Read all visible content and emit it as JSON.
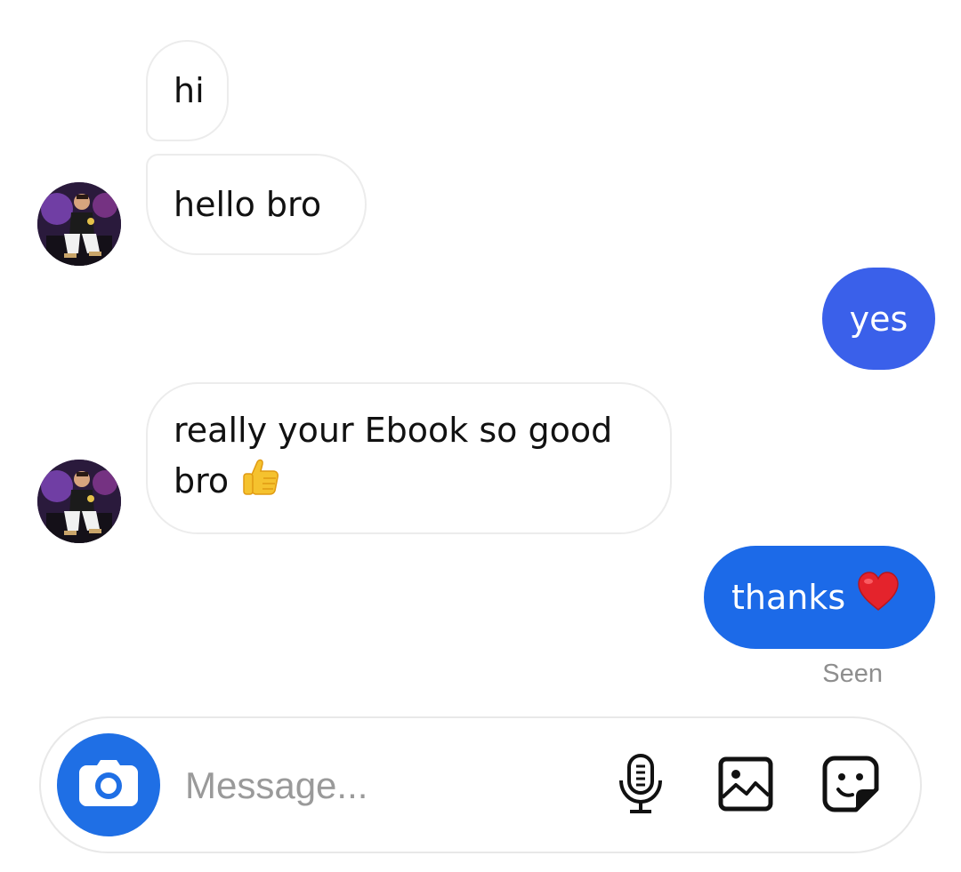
{
  "conversation": {
    "messages": [
      {
        "text": "hi",
        "sender": "other"
      },
      {
        "text": "hello bro",
        "sender": "other"
      },
      {
        "text": "yes",
        "sender": "me"
      },
      {
        "line1": "really your Ebook so good",
        "line2": "bro",
        "emoji": "thumbs-up",
        "sender": "other"
      },
      {
        "text": "thanks",
        "emoji": "red-heart",
        "sender": "me"
      }
    ],
    "seen_label": "Seen"
  },
  "composer": {
    "placeholder": "Message...",
    "camera_icon": "camera-icon",
    "mic_icon": "microphone-icon",
    "gallery_icon": "image-icon",
    "sticker_icon": "sticker-icon"
  },
  "colors": {
    "outgoing_bubble_1": "#3a60ea",
    "outgoing_bubble_2": "#1c6ae8",
    "camera_button": "#1f6fe5",
    "incoming_border": "#ececec",
    "seen_text": "#8e8e8e"
  }
}
